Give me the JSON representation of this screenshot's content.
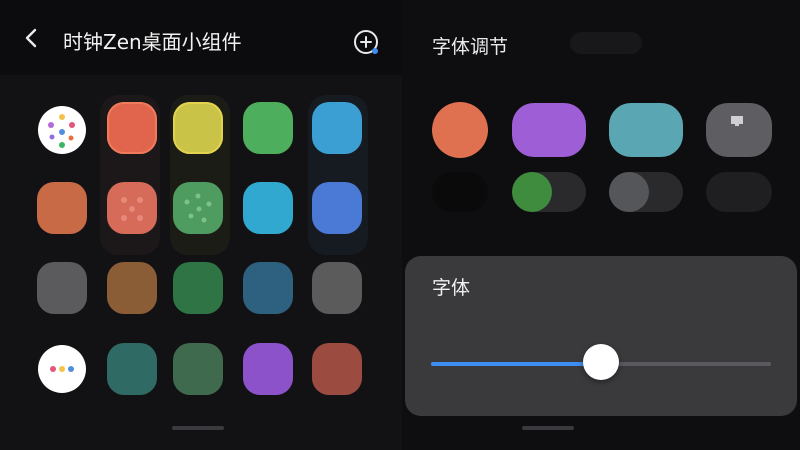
{
  "header": {
    "title": "时钟Zen桌面小组件"
  },
  "font_panel": {
    "title": "字体调节"
  },
  "font_card": {
    "title": "字体",
    "slider_value": 0.5
  },
  "icons": {
    "back": "chevron-left-icon",
    "add": "add-circle-icon"
  },
  "colors": {
    "accent": "#3d8ef0",
    "row1": [
      "#ffffff",
      "#e0654c",
      "#d2c246",
      "#4dae5d",
      "#3b9fd4"
    ],
    "row2": [
      "#c86a45",
      "#d56b58",
      "#4f9c60",
      "#30a8cf",
      "#4a79d6"
    ],
    "row3": [
      "#5b5b5e",
      "#8a5d37",
      "#2f7444",
      "#2e607f",
      "#5b5b5b"
    ],
    "row4": [
      "#ffffff",
      "#2f6b64",
      "#3f6a4d",
      "#8b52c9",
      "#9b4b40"
    ],
    "swatch_row1": [
      "#e07150",
      "#9d5ed6",
      "#5aa7b3",
      "#5e5e62"
    ],
    "swatch_row2": [
      "#0a0a0a",
      "#3f8c3f",
      "#55565a",
      "#2a2a2c"
    ]
  }
}
